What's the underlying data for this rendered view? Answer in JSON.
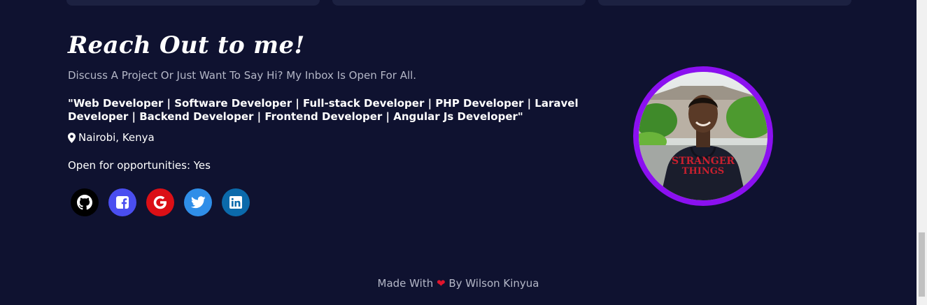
{
  "contact": {
    "heading": "Reach Out to me!",
    "subtext": "Discuss A Project Or Just Want To Say Hi? My Inbox Is Open For All.",
    "roles": "\"Web Developer | Software Developer | Full-stack Developer | PHP Developer | Laravel Developer | Backend Developer | Frontend Developer | Angular Js Developer\"",
    "location": "Nairobi, Kenya",
    "opportunities": "Open for opportunities: Yes",
    "socials": [
      {
        "icon": "github-icon",
        "color": "#000000"
      },
      {
        "icon": "facebook-icon",
        "color": "#4a4ef0"
      },
      {
        "icon": "google-icon",
        "color": "#db0f16"
      },
      {
        "icon": "twitter-icon",
        "color": "#2f8ee8"
      },
      {
        "icon": "linkedin-icon",
        "color": "#0b6aab"
      }
    ]
  },
  "footer": {
    "prefix": "Made With",
    "heart": "❤",
    "suffix": "By Wilson Kinyua"
  },
  "colors": {
    "background": "#0f1230",
    "avatar_ring": "#8b10f0",
    "muted_text": "#b4b7c7"
  }
}
